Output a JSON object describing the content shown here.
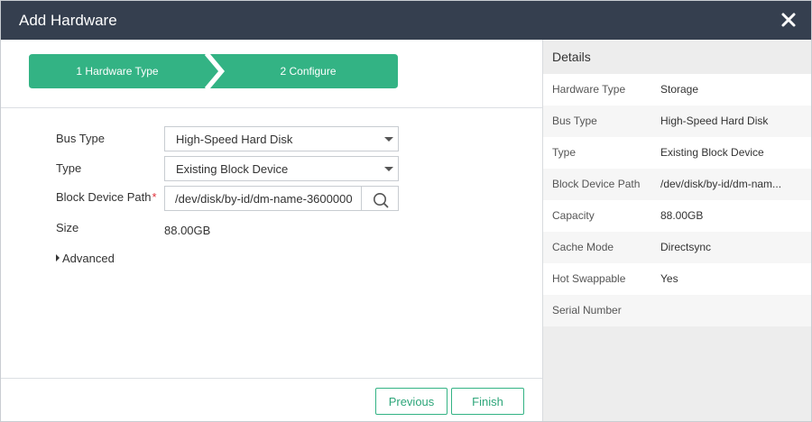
{
  "dialog": {
    "title": "Add Hardware",
    "close_icon": "close-icon"
  },
  "steps": [
    {
      "label": "1 Hardware Type"
    },
    {
      "label": "2 Configure"
    }
  ],
  "form": {
    "bus_type": {
      "label": "Bus Type",
      "value": "High-Speed Hard Disk"
    },
    "type": {
      "label": "Type",
      "value": "Existing Block Device"
    },
    "block_device_path": {
      "label": "Block Device Path",
      "required_mark": "*",
      "value": "/dev/disk/by-id/dm-name-3600000",
      "search_icon": "search-icon"
    },
    "size": {
      "label": "Size",
      "value": "88.00GB"
    },
    "advanced": {
      "label": "Advanced"
    }
  },
  "footer": {
    "previous_label": "Previous",
    "finish_label": "Finish"
  },
  "details": {
    "title": "Details",
    "rows": [
      {
        "key": "Hardware Type",
        "value": "Storage"
      },
      {
        "key": "Bus Type",
        "value": "High-Speed Hard Disk"
      },
      {
        "key": "Type",
        "value": "Existing Block Device"
      },
      {
        "key": "Block Device Path",
        "value": "/dev/disk/by-id/dm-nam..."
      },
      {
        "key": "Capacity",
        "value": "88.00GB"
      },
      {
        "key": "Cache Mode",
        "value": "Directsync"
      },
      {
        "key": "Hot Swappable",
        "value": "Yes"
      },
      {
        "key": "Serial Number",
        "value": ""
      }
    ]
  },
  "colors": {
    "titlebar": "#353f4f",
    "accent": "#33b384",
    "required": "#e0303a"
  }
}
